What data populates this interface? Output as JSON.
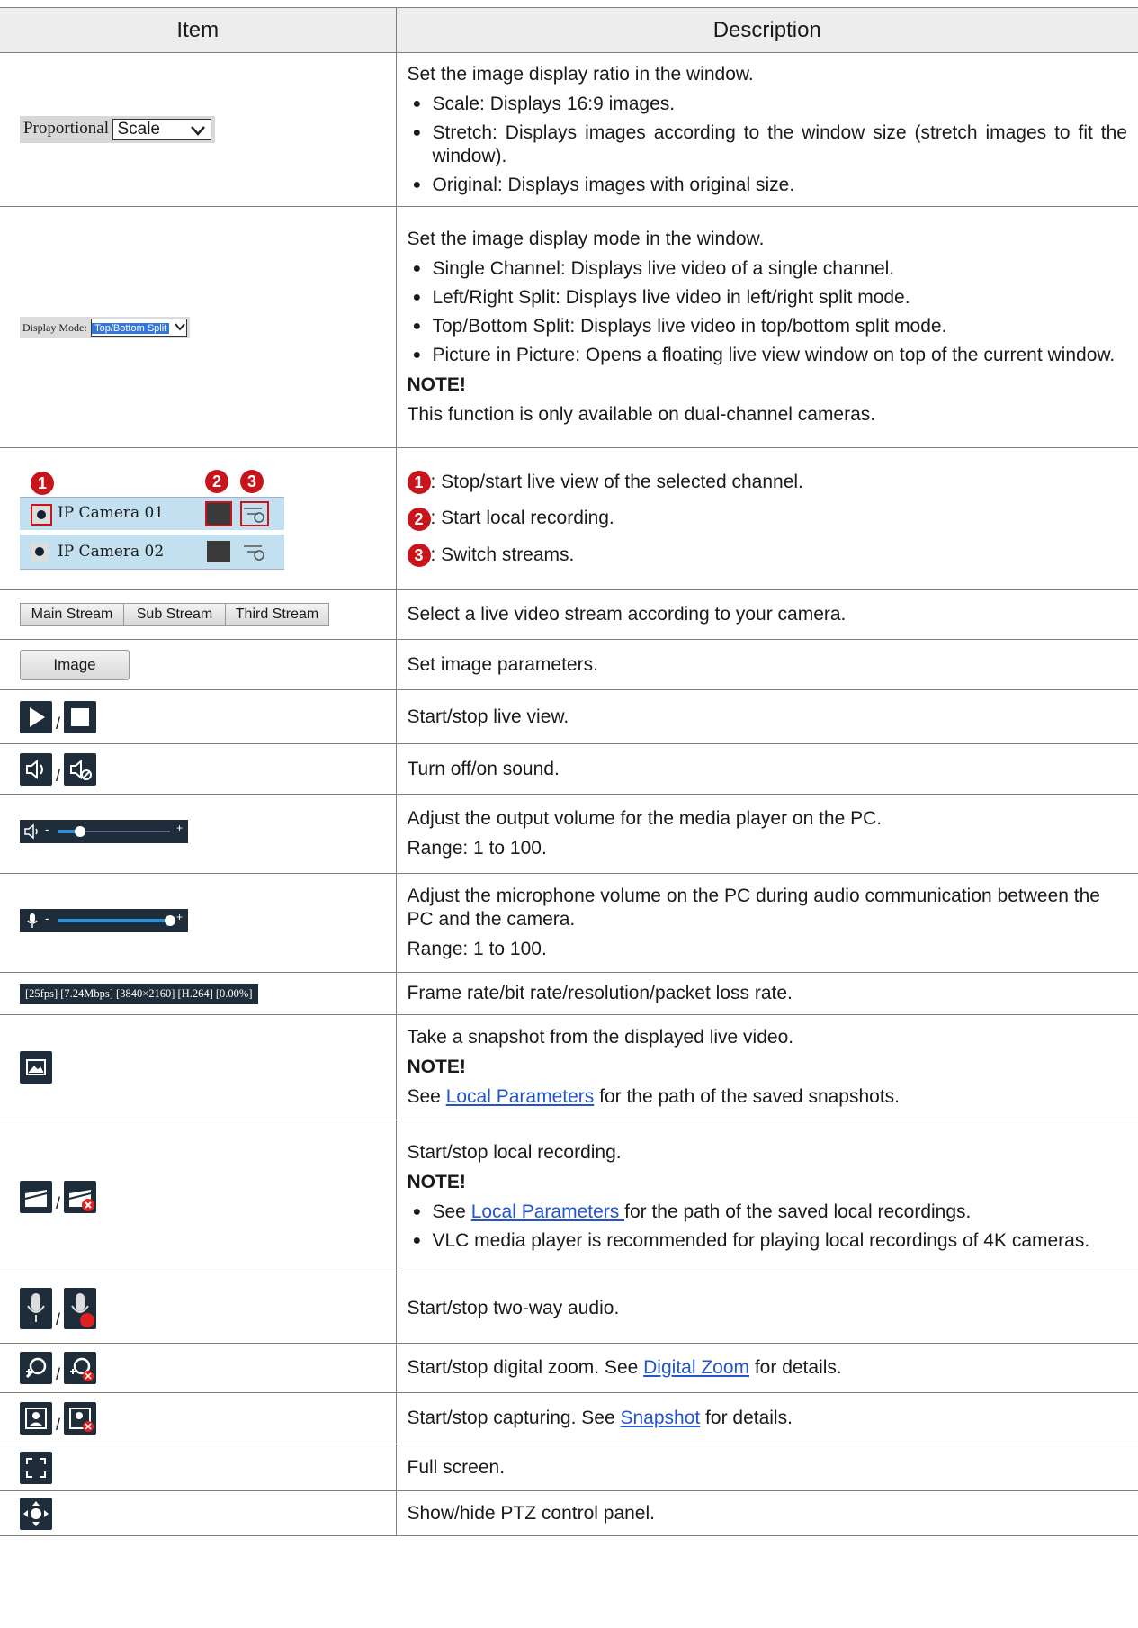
{
  "header": {
    "item": "Item",
    "description": "Description"
  },
  "rows": {
    "ratio": {
      "label": "Proportional",
      "select_value": "Scale",
      "intro": "Set the image display ratio in the window.",
      "bullets": [
        "Scale: Displays 16:9 images.",
        "Stretch: Displays images according to the window size (stretch images to fit the window).",
        "Original: Displays images with original size."
      ]
    },
    "mode": {
      "label": "Display Mode:",
      "select_value": "Top/Bottom Split",
      "intro": "Set the image display mode in the window.",
      "bullets": [
        "Single Channel: Displays live video of a single channel.",
        "Left/Right Split: Displays live video in left/right split mode.",
        "Top/Bottom Split: Displays live video in top/bottom split mode.",
        "Picture in Picture: Opens a floating live view window on top of the current window."
      ],
      "note_title": "NOTE!",
      "note": "This function is only available on dual-channel cameras."
    },
    "camera": {
      "cam1": "IP Camera 01",
      "cam2": "IP Camera 02",
      "markers": [
        "1",
        "2",
        "3"
      ],
      "desc": [
        ": Stop/start live view of the selected channel.",
        ": Start local recording.",
        ": Switch streams."
      ]
    },
    "streams": {
      "buttons": [
        "Main Stream",
        "Sub Stream",
        "Third Stream"
      ],
      "desc": "Select a live video stream according to your camera."
    },
    "image": {
      "button": "Image",
      "desc": "Set image parameters."
    },
    "liveview": {
      "sep": "/",
      "desc": "Start/stop live view."
    },
    "sound": {
      "sep": "/",
      "desc": "Turn off/on sound."
    },
    "volume": {
      "minus": "-",
      "plus": "+",
      "level_percent": 20,
      "desc": "Adjust the output volume for the media player on the PC.",
      "range": "Range: 1 to 100."
    },
    "mic": {
      "minus": "-",
      "plus": "+",
      "level_percent": 100,
      "desc": "Adjust the microphone volume on the PC during audio communication between the PC and the camera.",
      "range": "Range: 1 to 100."
    },
    "stats": {
      "text": "[25fps] [7.24Mbps] [3840×2160] [H.264] [0.00%]",
      "desc": "Frame rate/bit rate/resolution/packet loss rate."
    },
    "snapshot": {
      "desc": "Take a snapshot from the displayed live video.",
      "note_title": "NOTE!",
      "note_pre": "See ",
      "note_link": "Local Parameters",
      "note_post": " for the path of the saved snapshots."
    },
    "recording": {
      "sep": "/",
      "desc": "Start/stop local recording.",
      "note_title": "NOTE!",
      "b1_pre": "See ",
      "b1_link": "Local Parameters ",
      "b1_post": "for the path of the saved local recordings.",
      "b2": "VLC media player is recommended for playing local recordings of 4K cameras."
    },
    "audio": {
      "sep": "/",
      "desc": "Start/stop two-way audio."
    },
    "zoom": {
      "sep": "/",
      "pre": "Start/stop digital zoom. See ",
      "link": "Digital Zoom",
      "post": " for details."
    },
    "capture": {
      "sep": "/",
      "pre": "Start/stop capturing. See ",
      "link": "Snapshot",
      "post": " for details."
    },
    "fullscreen": {
      "desc": "Full screen."
    },
    "ptz": {
      "desc": "Show/hide PTZ control panel."
    }
  }
}
